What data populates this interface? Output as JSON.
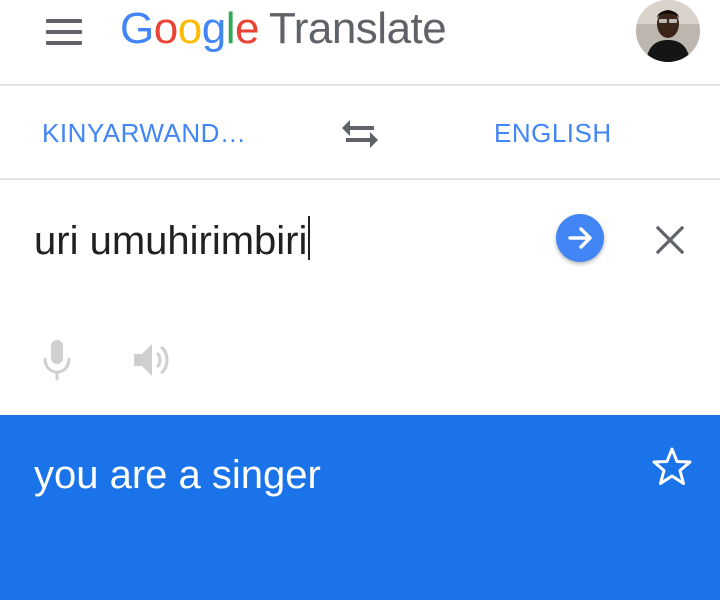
{
  "header": {
    "logo": {
      "letters": [
        {
          "char": "G",
          "color": "#4285f4"
        },
        {
          "char": "o",
          "color": "#ea4335"
        },
        {
          "char": "o",
          "color": "#fbbc05"
        },
        {
          "char": "g",
          "color": "#4285f4"
        },
        {
          "char": "l",
          "color": "#34a853"
        },
        {
          "char": "e",
          "color": "#ea4335"
        }
      ],
      "product": "Translate"
    },
    "menu_icon": "hamburger-menu-icon",
    "avatar": "user-avatar"
  },
  "languages": {
    "source": "KINYARWAND…",
    "target": "ENGLISH",
    "swap_icon": "swap-arrows-icon"
  },
  "input": {
    "text": "uri umuhirimbiri",
    "go_icon": "arrow-right-icon",
    "clear_icon": "close-icon",
    "mic_icon": "microphone-icon",
    "speaker_icon": "speaker-icon"
  },
  "result": {
    "text": "you are a singer",
    "star_icon": "star-outline-icon"
  },
  "colors": {
    "accent": "#4285f4",
    "result_background": "#1a73e8",
    "icon_gray": "#5f6368",
    "disabled_icon": "#cfcfcf"
  }
}
